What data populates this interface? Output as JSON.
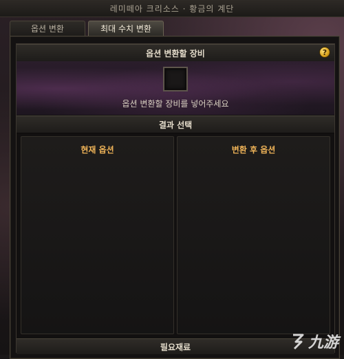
{
  "window": {
    "title": "레미떼아 크리소스 · 황금의 계단"
  },
  "tabs": [
    {
      "label": "옵션 변환",
      "active": false
    },
    {
      "label": "최대 수치 변환",
      "active": true
    }
  ],
  "equip_section": {
    "header": "옵션 변환할 장비",
    "hint": "옵션 변환할 장비를 넣어주세요",
    "help_icon": "?"
  },
  "result_section": {
    "header": "결과 선택",
    "current_title": "현재 옵션",
    "after_title": "변환 후 옵션"
  },
  "materials_section": {
    "header": "필요재료"
  },
  "watermark": {
    "text": "九游"
  },
  "colors": {
    "accent": "#f0b458",
    "help": "#d9a21c"
  }
}
